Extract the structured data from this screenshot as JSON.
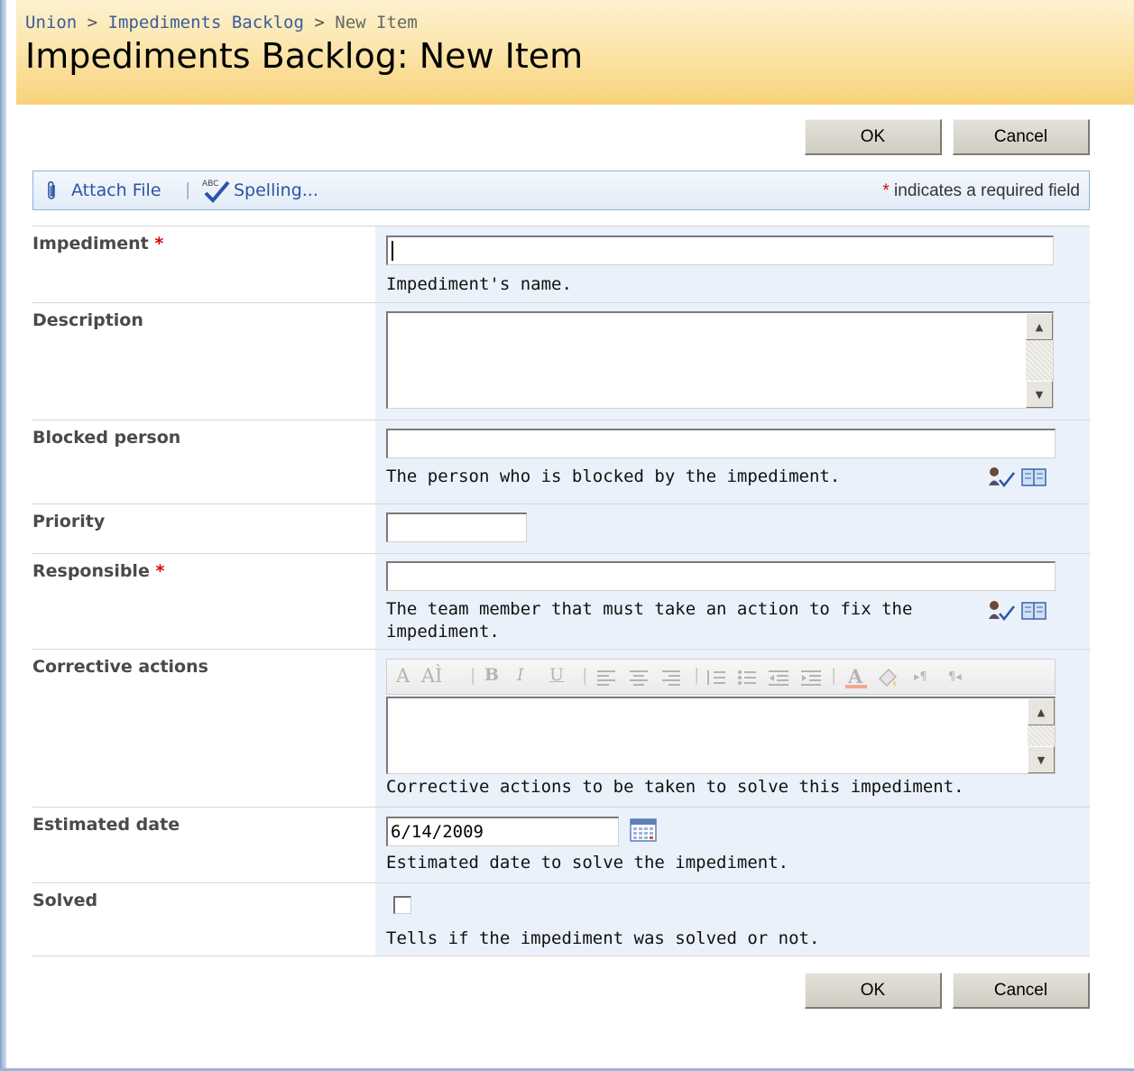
{
  "breadcrumb": {
    "items": [
      "Union",
      "Impediments Backlog",
      "New Item"
    ],
    "separator": ">"
  },
  "page_title": "Impediments Backlog: New Item",
  "buttons": {
    "ok": "OK",
    "cancel": "Cancel"
  },
  "toolbar": {
    "attach_file": "Attach File",
    "spelling": "Spelling...",
    "required_star": "*",
    "required_note": "indicates a required field"
  },
  "fields": {
    "impediment": {
      "label": "Impediment",
      "required": "*",
      "value": "",
      "description": "Impediment's name."
    },
    "description": {
      "label": "Description",
      "value": ""
    },
    "blocked_person": {
      "label": "Blocked person",
      "value": "",
      "description": "The person who is blocked by the impediment."
    },
    "priority": {
      "label": "Priority",
      "value": ""
    },
    "responsible": {
      "label": "Responsible",
      "required": "*",
      "value": "",
      "description_line1": "The team member that must take an action to fix the",
      "description_line2": "impediment."
    },
    "corrective_actions": {
      "label": "Corrective actions",
      "value": "",
      "description": "Corrective actions to be taken to solve this impediment."
    },
    "estimated_date": {
      "label": "Estimated date",
      "value": "6/14/2009",
      "description": "Estimated date to solve the impediment."
    },
    "solved": {
      "label": "Solved",
      "checked": false,
      "description": "Tells if the impediment was solved or not."
    }
  },
  "rte_buttons": [
    "A",
    "AÌ",
    "B",
    "I",
    "U"
  ],
  "icons": {
    "attach": "paperclip-icon",
    "spelling": "spellcheck-icon",
    "check_names": "check-names-icon",
    "browse": "address-book-icon",
    "calendar": "calendar-icon"
  },
  "colors": {
    "title_bar": "#fbe3a4",
    "field_background": "#eaf1fb",
    "link": "#2a55a3",
    "required": "#e00000"
  }
}
